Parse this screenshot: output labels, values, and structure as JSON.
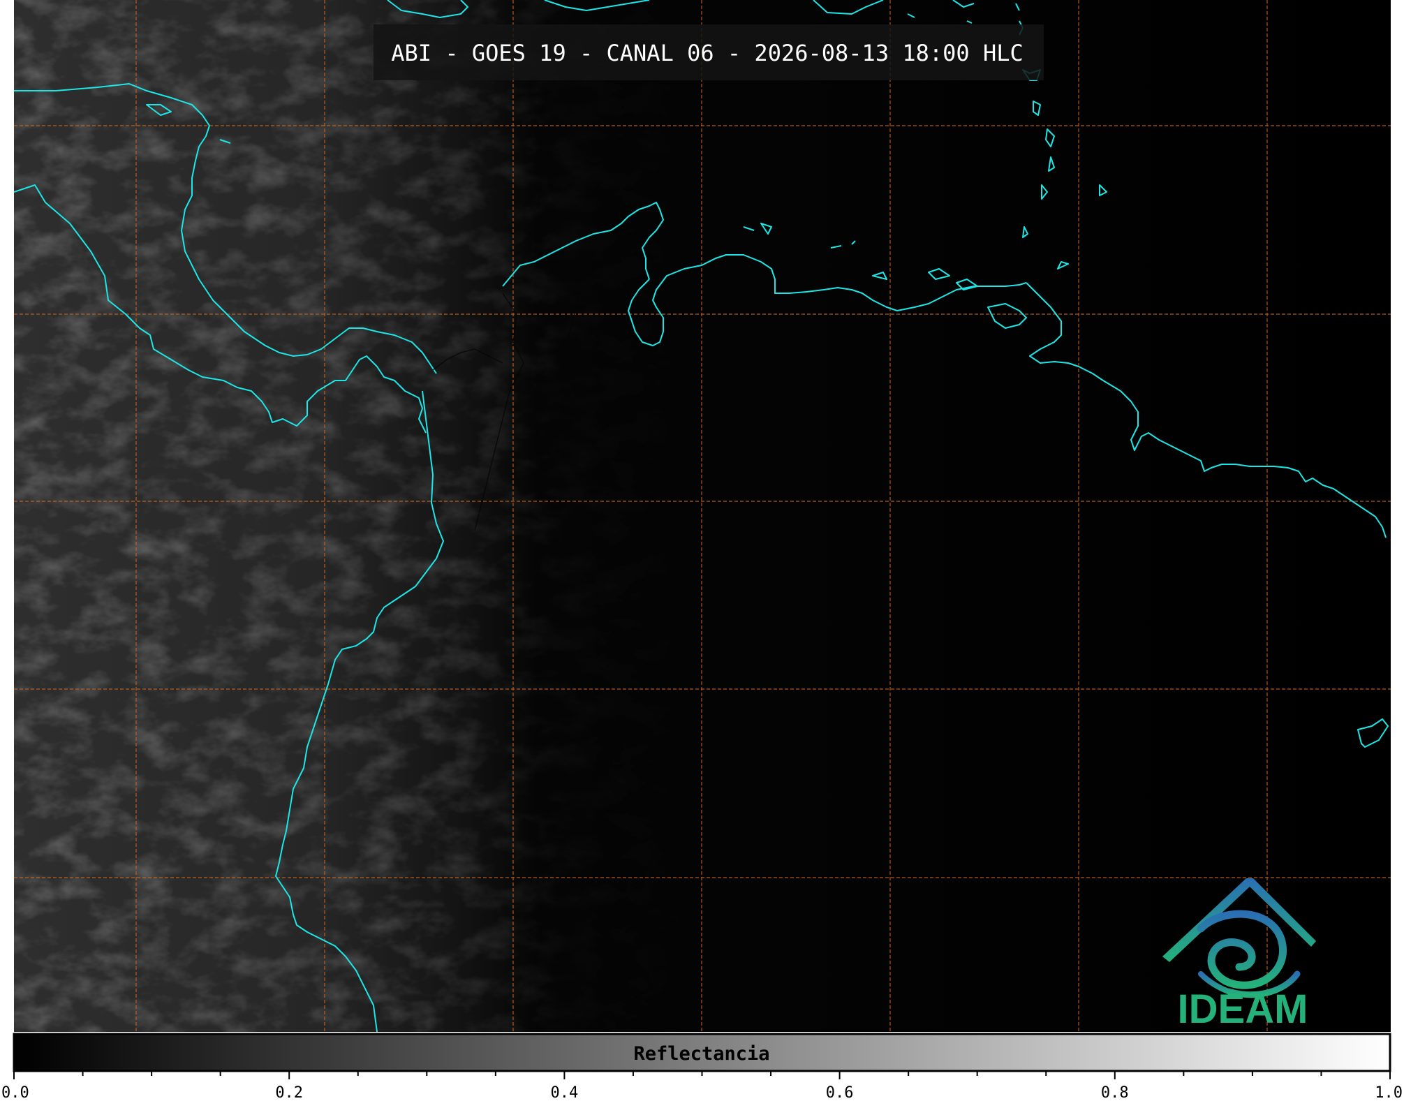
{
  "title": "ABI - GOES 19 - CANAL 06 - 2026-08-13 18:00 HLC",
  "colorbar": {
    "label": "Reflectancia",
    "ticks": [
      "0.0",
      "0.2",
      "0.4",
      "0.6",
      "0.8",
      "1.0"
    ],
    "range": [
      0.0,
      1.0
    ]
  },
  "logo": {
    "text": "IDEAM"
  },
  "colors": {
    "coastline": "#1ee6e6",
    "gridline": "#d2691e",
    "logo_green": "#25b27a",
    "logo_blue": "#2a7bb0",
    "background": "#000000"
  }
}
